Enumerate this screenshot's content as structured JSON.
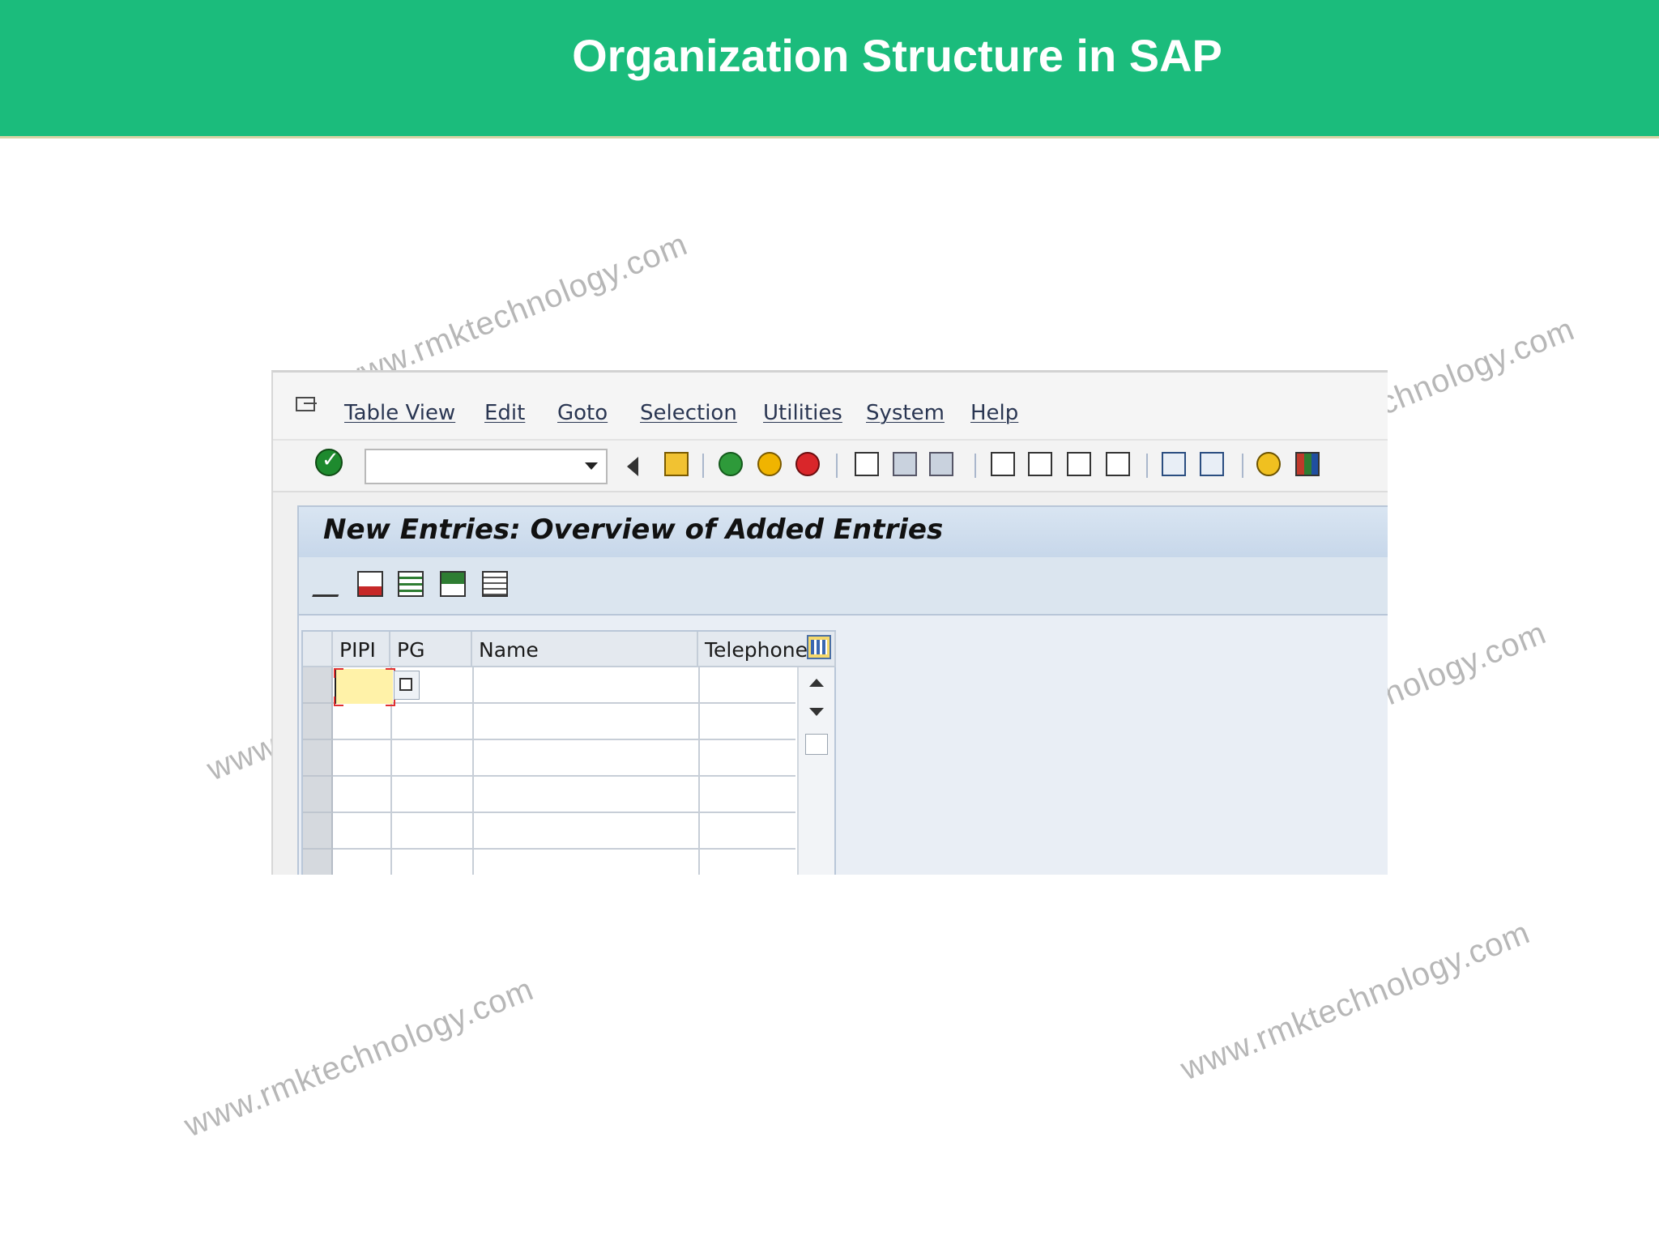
{
  "banner": {
    "title": "Organization Structure in SAP"
  },
  "watermarks": [
    "www.rmktechnology.com",
    "www.rmktechnology.com",
    "www.rmktechnology.com",
    "www.rmktechnology.com",
    "www.rmktechnology.com",
    "www.rmktechnology.com"
  ],
  "sap": {
    "menu": [
      "Table View",
      "Edit",
      "Goto",
      "Selection",
      "Utilities",
      "System",
      "Help"
    ],
    "command_field": {
      "value": ""
    },
    "toolbar_icons": [
      "enter-icon",
      "back-arrow-icon",
      "save-icon",
      "back-icon",
      "exit-icon",
      "cancel-icon",
      "print-icon",
      "find-icon",
      "find-next-icon",
      "first-page-icon",
      "previous-page-icon",
      "next-page-icon",
      "last-page-icon",
      "create-session-icon",
      "shortcut-icon",
      "help-icon",
      "layout-menu-icon"
    ],
    "page_title": "New Entries: Overview of Added Entries",
    "app_toolbar_icons": [
      "change-display-icon",
      "delete-row-icon",
      "select-all-icon",
      "select-block-icon",
      "deselect-all-icon"
    ],
    "table": {
      "columns": [
        "PIPI",
        "PG",
        "Name",
        "Telephone"
      ],
      "rows": [
        [
          "",
          "",
          "",
          ""
        ],
        [
          "",
          "",
          "",
          ""
        ],
        [
          "",
          "",
          "",
          ""
        ],
        [
          "",
          "",
          "",
          ""
        ],
        [
          "",
          "",
          "",
          ""
        ],
        [
          "",
          "",
          "",
          ""
        ]
      ]
    }
  }
}
